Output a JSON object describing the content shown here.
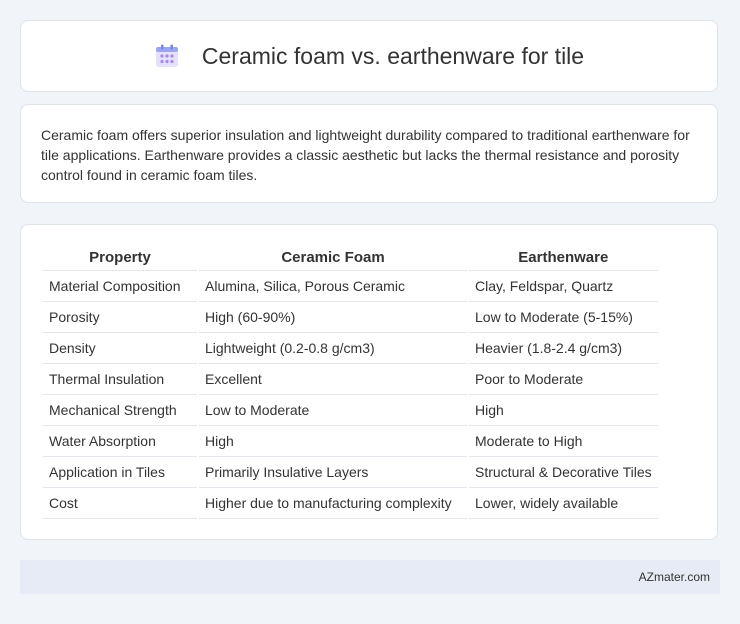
{
  "header": {
    "title": "Ceramic foam vs. earthenware for tile",
    "icon": "calendar-grid-icon"
  },
  "intro": {
    "text": "Ceramic foam offers superior insulation and lightweight durability compared to traditional earthenware for tile applications. Earthenware provides a classic aesthetic but lacks the thermal resistance and porosity control found in ceramic foam tiles."
  },
  "table": {
    "headers": [
      "Property",
      "Ceramic Foam",
      "Earthenware"
    ],
    "rows": [
      [
        "Material Composition",
        "Alumina, Silica, Porous Ceramic",
        "Clay, Feldspar, Quartz"
      ],
      [
        "Porosity",
        "High (60-90%)",
        "Low to Moderate (5-15%)"
      ],
      [
        "Density",
        "Lightweight (0.2-0.8 g/cm3)",
        "Heavier (1.8-2.4 g/cm3)"
      ],
      [
        "Thermal Insulation",
        "Excellent",
        "Poor to Moderate"
      ],
      [
        "Mechanical Strength",
        "Low to Moderate",
        "High"
      ],
      [
        "Water Absorption",
        "High",
        "Moderate to High"
      ],
      [
        "Application in Tiles",
        "Primarily Insulative Layers",
        "Structural & Decorative Tiles"
      ],
      [
        "Cost",
        "Higher due to manufacturing complexity",
        "Lower, widely available"
      ]
    ]
  },
  "footer": {
    "brand": "AZmater.com"
  }
}
